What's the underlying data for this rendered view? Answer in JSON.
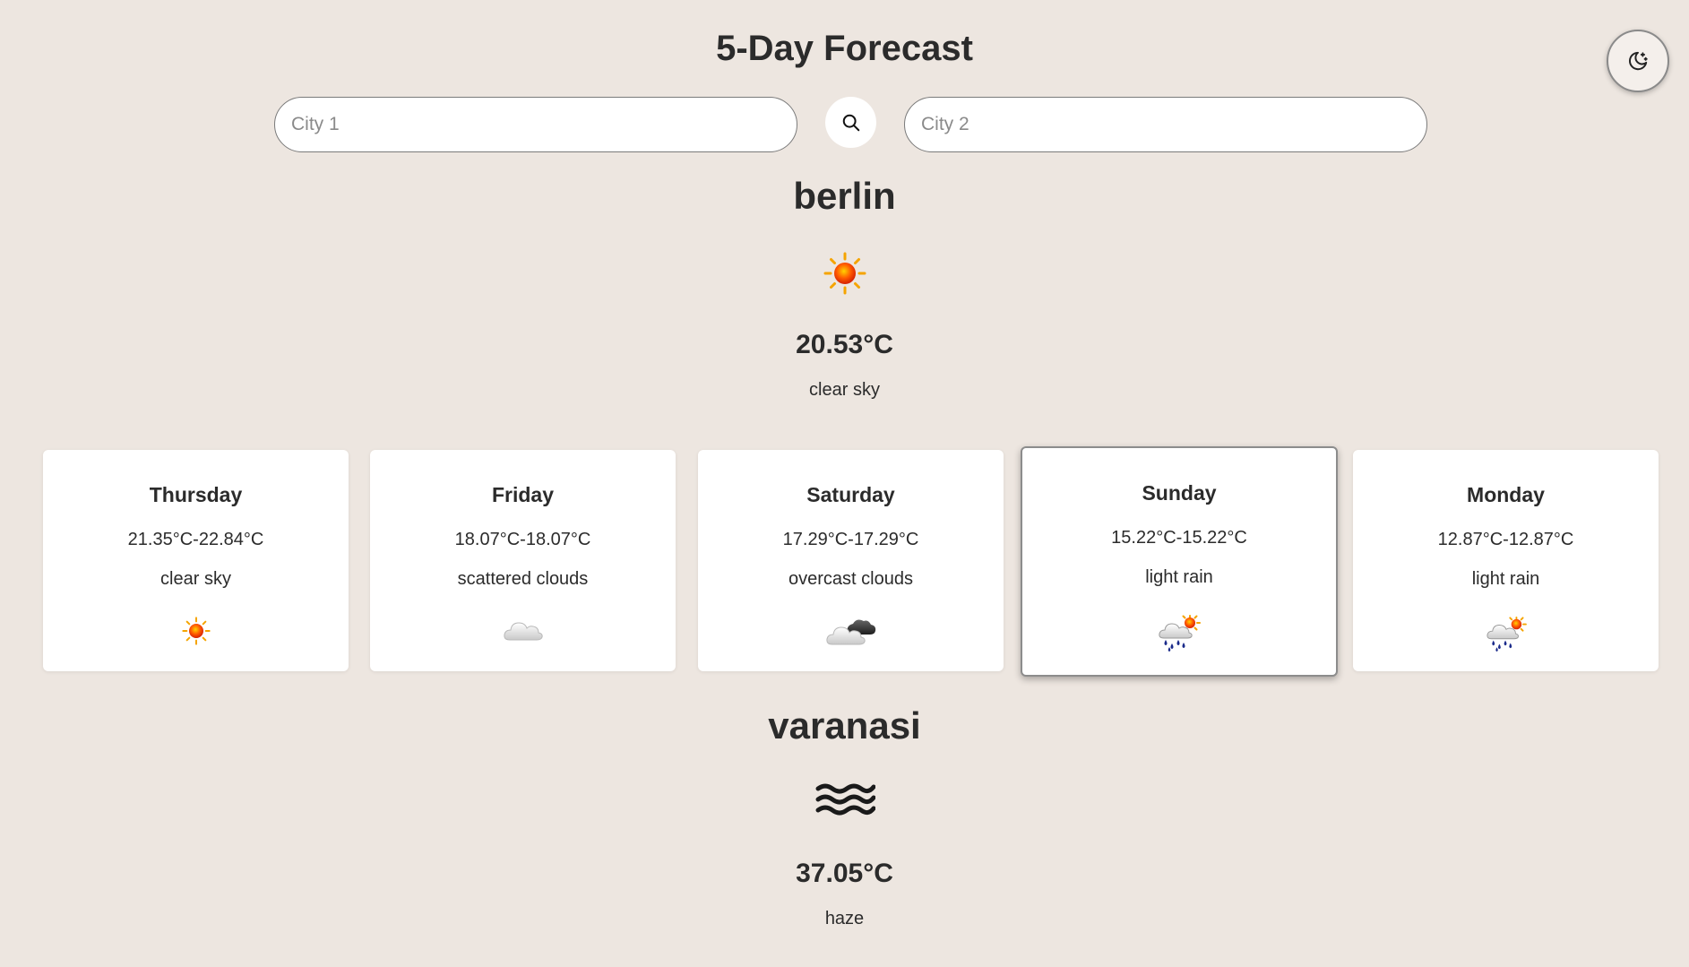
{
  "header": {
    "title": "5-Day Forecast",
    "theme_toggle_icon": "moon-stars-icon"
  },
  "search": {
    "city1_placeholder": "City 1",
    "city1_value": "",
    "search_icon": "search-icon",
    "city2_placeholder": "City 2",
    "city2_value": ""
  },
  "cities": [
    {
      "name": "berlin",
      "icon": "sun-icon",
      "temp": "20.53°C",
      "desc": "clear sky",
      "forecast": [
        {
          "day": "Thursday",
          "range": "21.35°C-22.84°C",
          "desc": "clear sky",
          "icon": "sun-icon"
        },
        {
          "day": "Friday",
          "range": "18.07°C-18.07°C",
          "desc": "scattered clouds",
          "icon": "cloud-icon"
        },
        {
          "day": "Saturday",
          "range": "17.29°C-17.29°C",
          "desc": "overcast clouds",
          "icon": "overcast-clouds-icon"
        },
        {
          "day": "Sunday",
          "range": "15.22°C-15.22°C",
          "desc": "light rain",
          "icon": "rain-sun-icon"
        },
        {
          "day": "Monday",
          "range": "12.87°C-12.87°C",
          "desc": "light rain",
          "icon": "rain-sun-icon"
        }
      ]
    },
    {
      "name": "varanasi",
      "icon": "haze-icon",
      "temp": "37.05°C",
      "desc": "haze"
    }
  ],
  "colors": {
    "background": "#ede6e0",
    "card": "#ffffff",
    "text": "#2b2b2b"
  }
}
